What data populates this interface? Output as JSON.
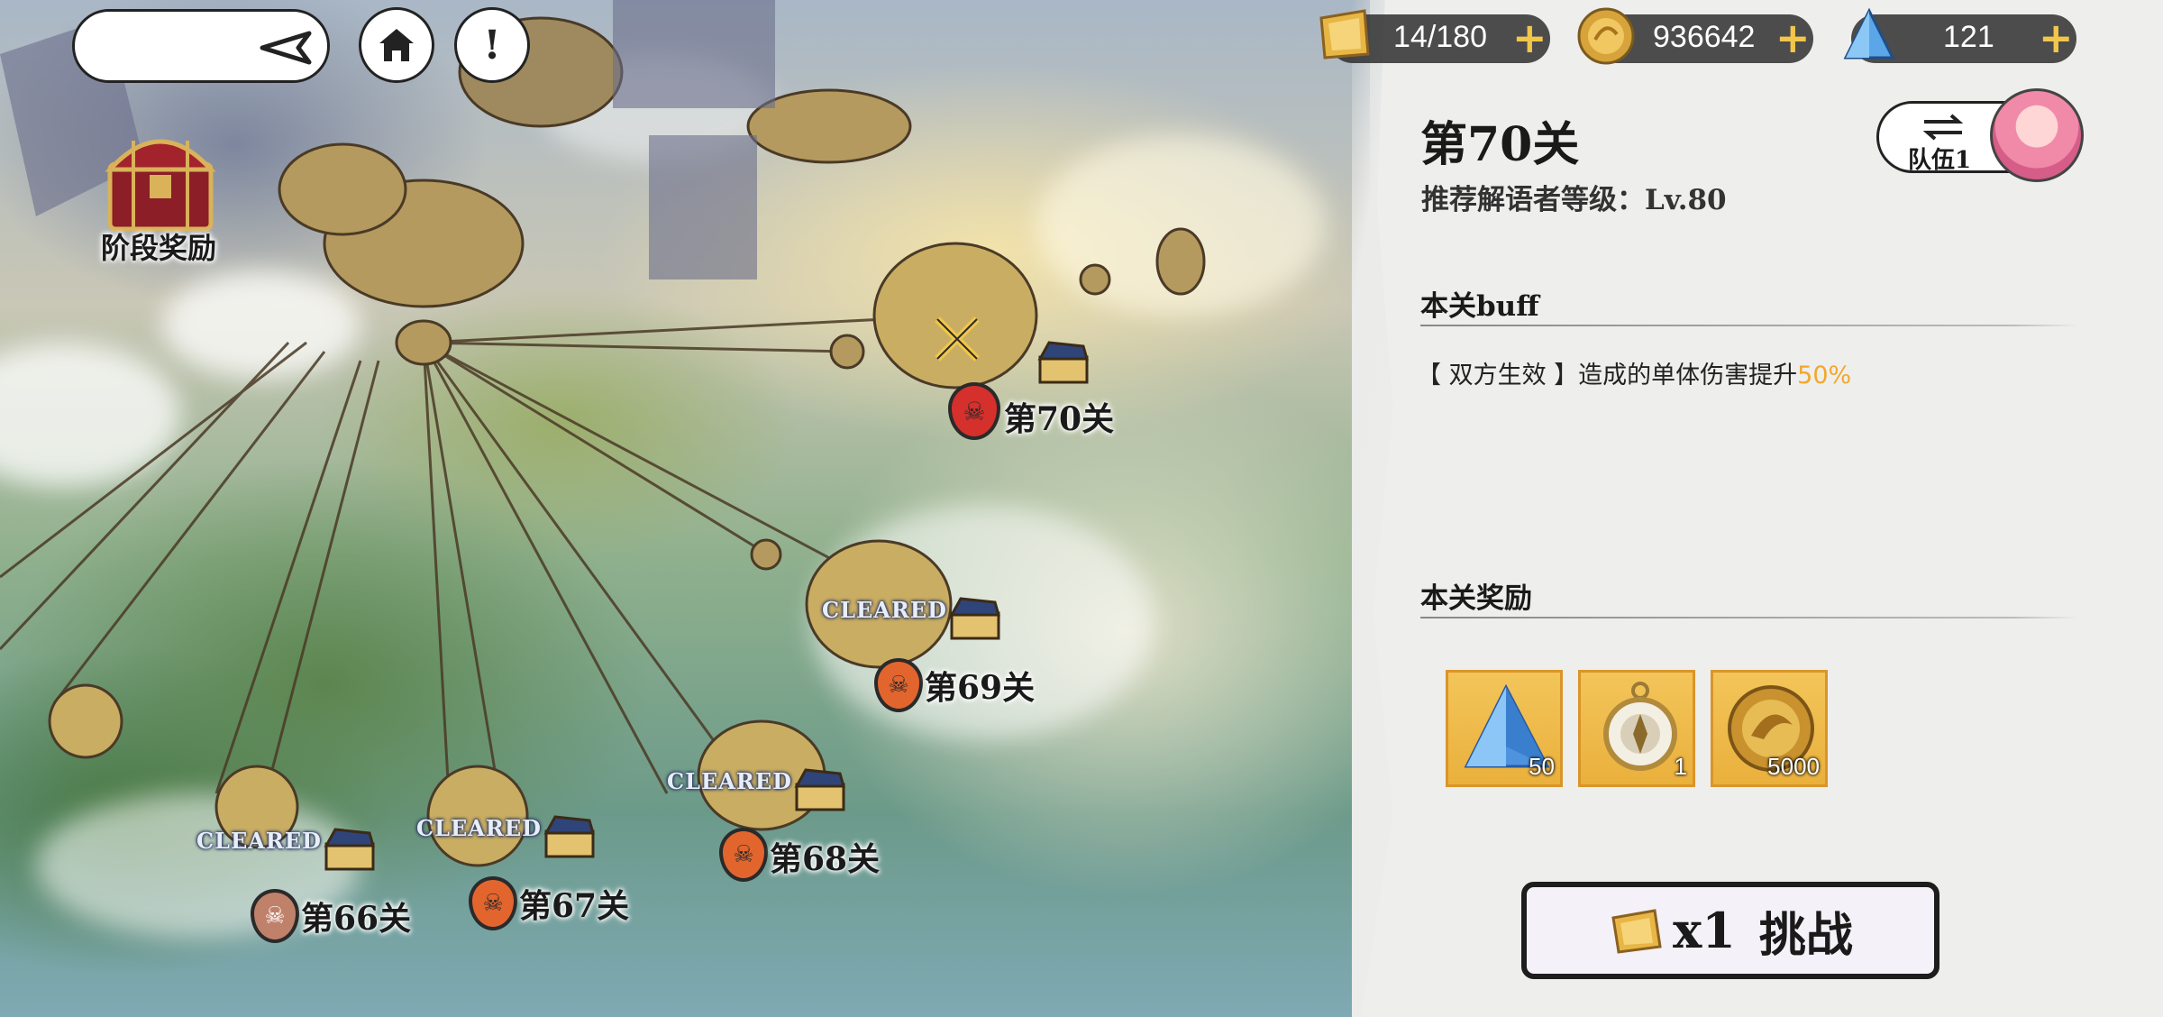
{
  "topbar": {
    "stamina": "14/180",
    "coins": "936642",
    "gems": "121"
  },
  "phase_reward_label": "阶段奖励",
  "stages": [
    {
      "label": "第66关",
      "cleared_text": "CLEARED"
    },
    {
      "label": "第67关",
      "cleared_text": "CLEARED"
    },
    {
      "label": "第68关",
      "cleared_text": "CLEARED"
    },
    {
      "label": "第69关",
      "cleared_text": "CLEARED"
    },
    {
      "label": "第70关",
      "cleared_text": ""
    }
  ],
  "panel": {
    "title": "第70关",
    "recommend": "推荐解语者等级：Lv.80",
    "team_label": "队伍1",
    "buff_heading": "本关buff",
    "buff_text_prefix": "【 双方生效 】造成的单体伤害提升",
    "buff_value": "50%",
    "reward_heading": "本关奖励",
    "rewards": [
      {
        "icon": "crystal-icon",
        "qty": "50"
      },
      {
        "icon": "compass-icon",
        "qty": "1"
      },
      {
        "icon": "gold-coin-icon",
        "qty": "5000"
      }
    ],
    "challenge_cost": "x1",
    "challenge_label": "挑战"
  },
  "colors": {
    "accent_gold": "#f1c64a",
    "buff_highlight": "#f3a72a",
    "skull_orange": "#e2652e",
    "skull_red": "#d5302c"
  }
}
